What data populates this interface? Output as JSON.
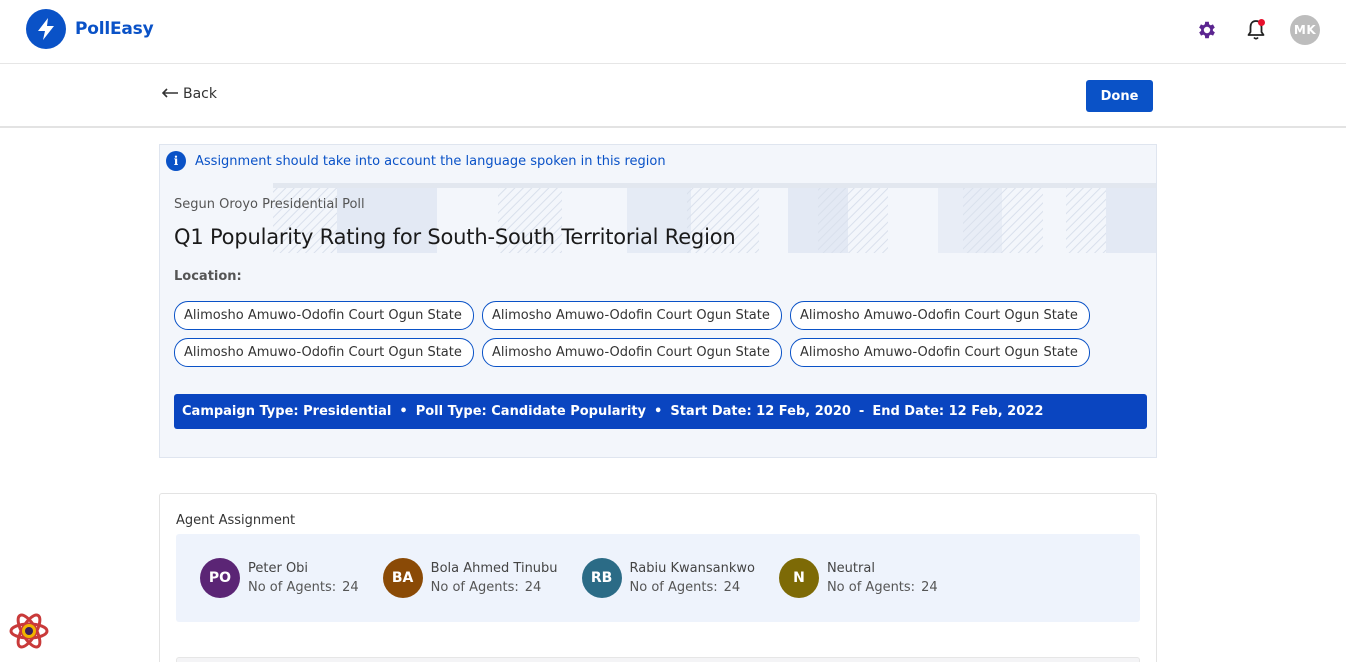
{
  "app": {
    "name": "PollEasy",
    "user_initials": "MK"
  },
  "subbar": {
    "back_label": "Back",
    "done_label": "Done"
  },
  "notice": {
    "text": "Assignment should take into account the language spoken in this region"
  },
  "poll": {
    "subtitle": "Segun Oroyo Presidential Poll",
    "title": "Q1 Popularity Rating for South-South Territorial Region",
    "location_label": "Location:",
    "locations": [
      "Alimosho Amuwo-Odofin Court Ogun State",
      "Alimosho Amuwo-Odofin Court Ogun State",
      "Alimosho Amuwo-Odofin Court Ogun State",
      "Alimosho Amuwo-Odofin Court Ogun State",
      "Alimosho Amuwo-Odofin Court Ogun State",
      "Alimosho Amuwo-Odofin Court Ogun State"
    ]
  },
  "campaign": {
    "type_label": "Campaign Type:",
    "type_value": "Presidential",
    "poll_type_label": "Poll Type:",
    "poll_type_value": "Candidate Popularity",
    "start_label": "Start Date:",
    "start_value": "12 Feb, 2020",
    "end_label": "End Date:",
    "end_value": "12 Feb, 2022",
    "bullet": "•",
    "dash": "-"
  },
  "agent_assignment": {
    "title": "Agent Assignment",
    "count_label": "No of Agents:",
    "agents": [
      {
        "initials": "PO",
        "name": "Peter Obi",
        "count": "24",
        "color": "#5b2575"
      },
      {
        "initials": "BA",
        "name": "Bola Ahmed Tinubu",
        "count": "24",
        "color": "#8a4a06"
      },
      {
        "initials": "RB",
        "name": "Rabiu Kwansankwo",
        "count": "24",
        "color": "#2b6b86"
      },
      {
        "initials": "N",
        "name": "Neutral",
        "count": "24",
        "color": "#7d6a06"
      }
    ]
  },
  "colors": {
    "primary": "#0a52c7",
    "gear": "#5b2590",
    "notification_dot": "#e8102c"
  },
  "icons": [
    "bolt-icon",
    "gear-icon",
    "bell-icon",
    "arrow-left-icon",
    "info-icon",
    "react-icon"
  ]
}
